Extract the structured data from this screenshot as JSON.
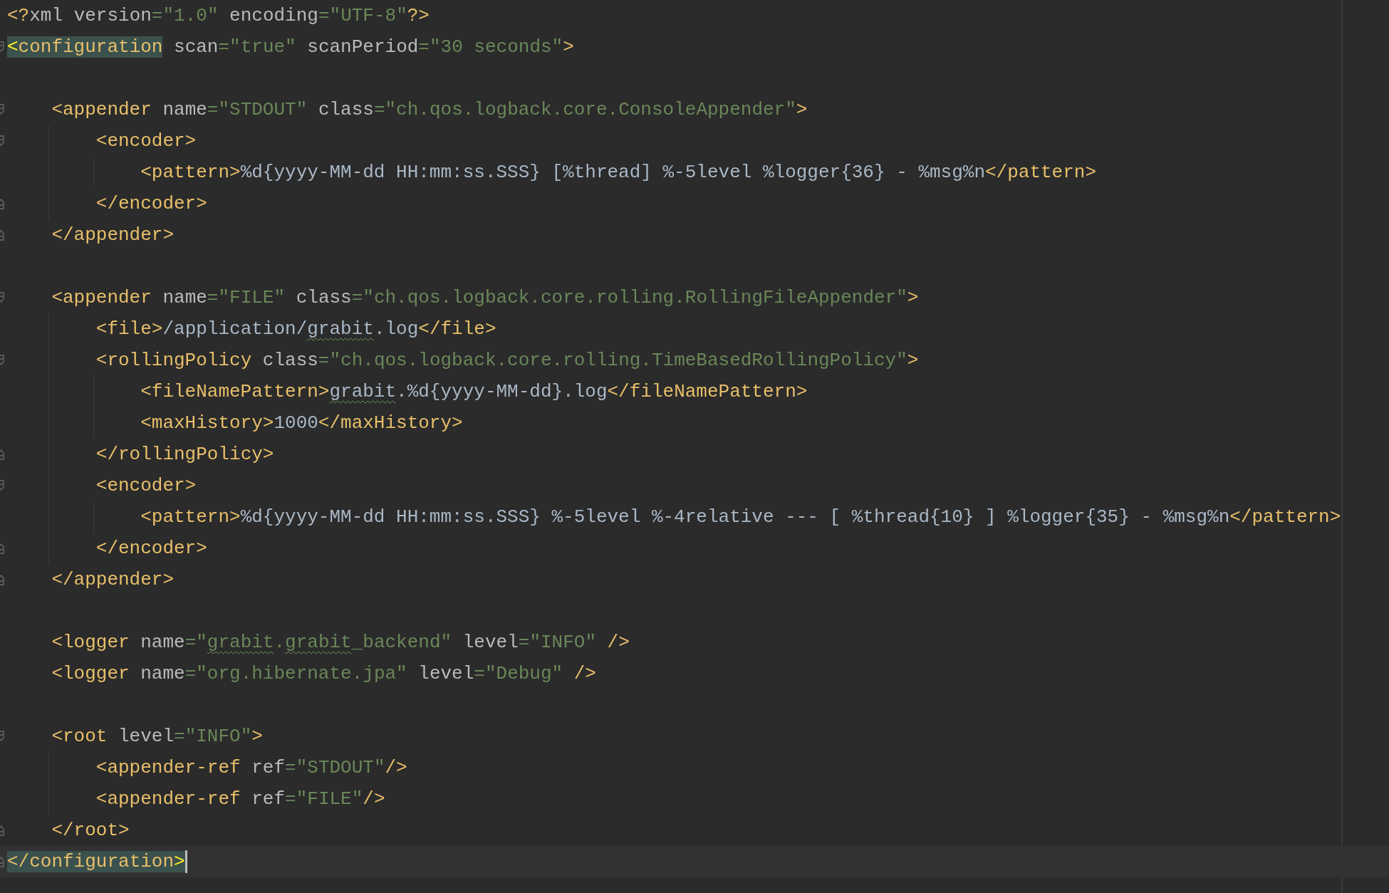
{
  "editor": {
    "lines": [
      {
        "kind": "code",
        "current": false,
        "tokens": [
          {
            "kind": "tag",
            "text": "<?"
          },
          {
            "kind": "attr",
            "text": "xml version"
          },
          {
            "kind": "eq",
            "text": "="
          },
          {
            "kind": "value",
            "text": "\"1.0\""
          },
          {
            "kind": "attr",
            "text": " encoding"
          },
          {
            "kind": "eq",
            "text": "="
          },
          {
            "kind": "value",
            "text": "\"UTF-8\""
          },
          {
            "kind": "tag",
            "text": "?>"
          }
        ]
      },
      {
        "kind": "code",
        "current": false,
        "tokens": [
          {
            "kind": "match-bracket",
            "text": "<"
          },
          {
            "kind": "match-tag",
            "text": "configuration"
          },
          {
            "kind": "attr",
            "text": " scan"
          },
          {
            "kind": "eq",
            "text": "="
          },
          {
            "kind": "value",
            "text": "\"true\""
          },
          {
            "kind": "attr",
            "text": " scanPeriod"
          },
          {
            "kind": "eq",
            "text": "="
          },
          {
            "kind": "value",
            "text": "\"30 seconds\""
          },
          {
            "kind": "tag",
            "text": ">"
          }
        ],
        "children": [
          {
            "kind": "blank",
            "current": false
          },
          {
            "kind": "code",
            "current": false,
            "tokens": [
              {
                "kind": "tag",
                "text": "<appender"
              },
              {
                "kind": "attr",
                "text": " name"
              },
              {
                "kind": "eq",
                "text": "="
              },
              {
                "kind": "value",
                "text": "\"STDOUT\""
              },
              {
                "kind": "attr",
                "text": " class"
              },
              {
                "kind": "eq",
                "text": "="
              },
              {
                "kind": "value",
                "text": "\"ch.qos.logback.core.ConsoleAppender\""
              },
              {
                "kind": "tag",
                "text": ">"
              }
            ],
            "children": [
              {
                "kind": "code",
                "current": false,
                "tokens": [
                  {
                    "kind": "tag",
                    "text": "<encoder>"
                  }
                ],
                "children": [
                  {
                    "kind": "code",
                    "current": false,
                    "tokens": [
                      {
                        "kind": "tag",
                        "text": "<pattern>"
                      },
                      {
                        "kind": "text",
                        "text": "%d{yyyy-MM-dd HH:mm:ss.SSS} [%thread] %-5level %logger{36} - %msg%n"
                      },
                      {
                        "kind": "tag",
                        "text": "</pattern>"
                      }
                    ]
                  }
                ]
              },
              {
                "kind": "code",
                "current": false,
                "tokens": [
                  {
                    "kind": "tag",
                    "text": "</encoder>"
                  }
                ]
              }
            ]
          },
          {
            "kind": "code",
            "current": false,
            "tokens": [
              {
                "kind": "tag",
                "text": "</appender>"
              }
            ]
          },
          {
            "kind": "blank",
            "current": false
          },
          {
            "kind": "code",
            "current": false,
            "tokens": [
              {
                "kind": "tag",
                "text": "<appender"
              },
              {
                "kind": "attr",
                "text": " name"
              },
              {
                "kind": "eq",
                "text": "="
              },
              {
                "kind": "value",
                "text": "\"FILE\""
              },
              {
                "kind": "attr",
                "text": " class"
              },
              {
                "kind": "eq",
                "text": "="
              },
              {
                "kind": "value",
                "text": "\"ch.qos.logback.core.rolling.RollingFileAppender\""
              },
              {
                "kind": "tag",
                "text": ">"
              }
            ],
            "children": [
              {
                "kind": "code",
                "current": false,
                "tokens": [
                  {
                    "kind": "tag",
                    "text": "<file>"
                  },
                  {
                    "kind": "text",
                    "text": "/application/"
                  },
                  {
                    "kind": "text-typo",
                    "text": "grabit"
                  },
                  {
                    "kind": "text",
                    "text": ".log"
                  },
                  {
                    "kind": "tag",
                    "text": "</file>"
                  }
                ]
              },
              {
                "kind": "code",
                "current": false,
                "tokens": [
                  {
                    "kind": "tag",
                    "text": "<rollingPolicy"
                  },
                  {
                    "kind": "attr",
                    "text": " class"
                  },
                  {
                    "kind": "eq",
                    "text": "="
                  },
                  {
                    "kind": "value",
                    "text": "\"ch.qos.logback.core.rolling.TimeBasedRollingPolicy\""
                  },
                  {
                    "kind": "tag",
                    "text": ">"
                  }
                ],
                "children": [
                  {
                    "kind": "code",
                    "current": false,
                    "tokens": [
                      {
                        "kind": "tag",
                        "text": "<fileNamePattern>"
                      },
                      {
                        "kind": "text-typo",
                        "text": "grabit"
                      },
                      {
                        "kind": "text",
                        "text": ".%d{yyyy-MM-dd}.log"
                      },
                      {
                        "kind": "tag",
                        "text": "</fileNamePattern>"
                      }
                    ]
                  },
                  {
                    "kind": "code",
                    "current": false,
                    "tokens": [
                      {
                        "kind": "tag",
                        "text": "<maxHistory>"
                      },
                      {
                        "kind": "text",
                        "text": "1000"
                      },
                      {
                        "kind": "tag",
                        "text": "</maxHistory>"
                      }
                    ]
                  }
                ]
              },
              {
                "kind": "code",
                "current": false,
                "tokens": [
                  {
                    "kind": "tag",
                    "text": "</rollingPolicy>"
                  }
                ]
              },
              {
                "kind": "code",
                "current": false,
                "tokens": [
                  {
                    "kind": "tag",
                    "text": "<encoder>"
                  }
                ],
                "children": [
                  {
                    "kind": "code",
                    "current": false,
                    "tokens": [
                      {
                        "kind": "tag",
                        "text": "<pattern>"
                      },
                      {
                        "kind": "text",
                        "text": "%d{yyyy-MM-dd HH:mm:ss.SSS} %-5level %-4relative --- [ %thread{10} ] %logger{35} - %msg%n"
                      },
                      {
                        "kind": "tag",
                        "text": "</pattern>"
                      }
                    ]
                  }
                ]
              },
              {
                "kind": "code",
                "current": false,
                "tokens": [
                  {
                    "kind": "tag",
                    "text": "</encoder>"
                  }
                ]
              }
            ]
          },
          {
            "kind": "code",
            "current": false,
            "tokens": [
              {
                "kind": "tag",
                "text": "</appender>"
              }
            ]
          },
          {
            "kind": "blank",
            "current": false
          },
          {
            "kind": "code",
            "current": false,
            "tokens": [
              {
                "kind": "tag",
                "text": "<logger"
              },
              {
                "kind": "attr",
                "text": " name"
              },
              {
                "kind": "eq",
                "text": "="
              },
              {
                "kind": "value",
                "text": "\""
              },
              {
                "kind": "value-typo",
                "text": "grabit"
              },
              {
                "kind": "value",
                "text": "."
              },
              {
                "kind": "value-typo",
                "text": "grabit"
              },
              {
                "kind": "value",
                "text": "_backend\""
              },
              {
                "kind": "attr",
                "text": " level"
              },
              {
                "kind": "eq",
                "text": "="
              },
              {
                "kind": "value",
                "text": "\"INFO\""
              },
              {
                "kind": "tag",
                "text": " />"
              }
            ]
          },
          {
            "kind": "code",
            "current": false,
            "tokens": [
              {
                "kind": "tag",
                "text": "<logger"
              },
              {
                "kind": "attr",
                "text": " name"
              },
              {
                "kind": "eq",
                "text": "="
              },
              {
                "kind": "value",
                "text": "\"org.hibernate.jpa\""
              },
              {
                "kind": "attr",
                "text": " level"
              },
              {
                "kind": "eq",
                "text": "="
              },
              {
                "kind": "value",
                "text": "\"Debug\""
              },
              {
                "kind": "tag",
                "text": " />"
              }
            ]
          },
          {
            "kind": "blank",
            "current": false
          },
          {
            "kind": "code",
            "current": false,
            "tokens": [
              {
                "kind": "tag",
                "text": "<root"
              },
              {
                "kind": "attr",
                "text": " level"
              },
              {
                "kind": "eq",
                "text": "="
              },
              {
                "kind": "value",
                "text": "\"INFO\""
              },
              {
                "kind": "tag",
                "text": ">"
              }
            ],
            "children": [
              {
                "kind": "code",
                "current": false,
                "tokens": [
                  {
                    "kind": "tag",
                    "text": "<appender-ref"
                  },
                  {
                    "kind": "attr",
                    "text": " ref"
                  },
                  {
                    "kind": "eq",
                    "text": "="
                  },
                  {
                    "kind": "value",
                    "text": "\"STDOUT\""
                  },
                  {
                    "kind": "tag",
                    "text": "/>"
                  }
                ]
              },
              {
                "kind": "code",
                "current": false,
                "tokens": [
                  {
                    "kind": "tag",
                    "text": "<appender-ref"
                  },
                  {
                    "kind": "attr",
                    "text": " ref"
                  },
                  {
                    "kind": "eq",
                    "text": "="
                  },
                  {
                    "kind": "value",
                    "text": "\"FILE\""
                  },
                  {
                    "kind": "tag",
                    "text": "/>"
                  }
                ]
              }
            ]
          },
          {
            "kind": "code",
            "current": false,
            "tokens": [
              {
                "kind": "tag",
                "text": "</root>"
              }
            ]
          }
        ]
      },
      {
        "kind": "code",
        "current": true,
        "tokens": [
          {
            "kind": "match-tag",
            "text": "</configuration"
          },
          {
            "kind": "match-bracket",
            "text": ">"
          }
        ]
      }
    ]
  }
}
